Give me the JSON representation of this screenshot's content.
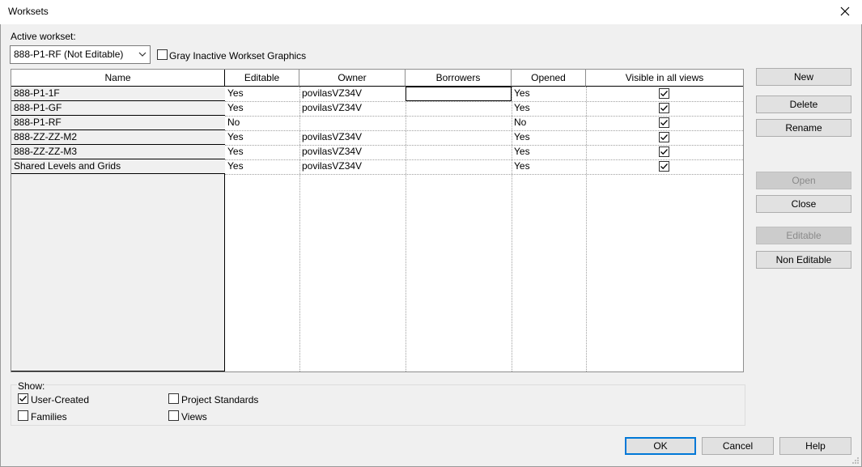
{
  "window": {
    "title": "Worksets"
  },
  "active_workset": {
    "label": "Active workset:",
    "value": "888-P1-RF (Not Editable)"
  },
  "gray_inactive": {
    "label": "Gray Inactive Workset Graphics",
    "checked": false
  },
  "table": {
    "columns": [
      "Name",
      "Editable",
      "Owner",
      "Borrowers",
      "Opened",
      "Visible in all views"
    ],
    "rows": [
      {
        "name": "888-P1-1F",
        "editable": "Yes",
        "owner": "povilasVZ34V",
        "borrowers": "",
        "opened": "Yes",
        "visible": true
      },
      {
        "name": "888-P1-GF",
        "editable": "Yes",
        "owner": "povilasVZ34V",
        "borrowers": "",
        "opened": "Yes",
        "visible": true
      },
      {
        "name": "888-P1-RF",
        "editable": "No",
        "owner": "",
        "borrowers": "",
        "opened": "No",
        "visible": true
      },
      {
        "name": "888-ZZ-ZZ-M2",
        "editable": "Yes",
        "owner": "povilasVZ34V",
        "borrowers": "",
        "opened": "Yes",
        "visible": true
      },
      {
        "name": "888-ZZ-ZZ-M3",
        "editable": "Yes",
        "owner": "povilasVZ34V",
        "borrowers": "",
        "opened": "Yes",
        "visible": true
      },
      {
        "name": "Shared Levels and Grids",
        "editable": "Yes",
        "owner": "povilasVZ34V",
        "borrowers": "",
        "opened": "Yes",
        "visible": true
      }
    ]
  },
  "side_buttons": {
    "new": "New",
    "delete": "Delete",
    "rename": "Rename",
    "open": "Open",
    "close": "Close",
    "editable": "Editable",
    "non_editable": "Non Editable"
  },
  "show": {
    "label": "Show:",
    "user_created": {
      "label": "User-Created",
      "checked": true
    },
    "families": {
      "label": "Families",
      "checked": false
    },
    "project_standards": {
      "label": "Project Standards",
      "checked": false
    },
    "views": {
      "label": "Views",
      "checked": false
    }
  },
  "footer": {
    "ok": "OK",
    "cancel": "Cancel",
    "help": "Help"
  },
  "icons": [
    "close-icon",
    "chevron-down-icon",
    "checkmark-icon",
    "resize-grip-icon"
  ]
}
